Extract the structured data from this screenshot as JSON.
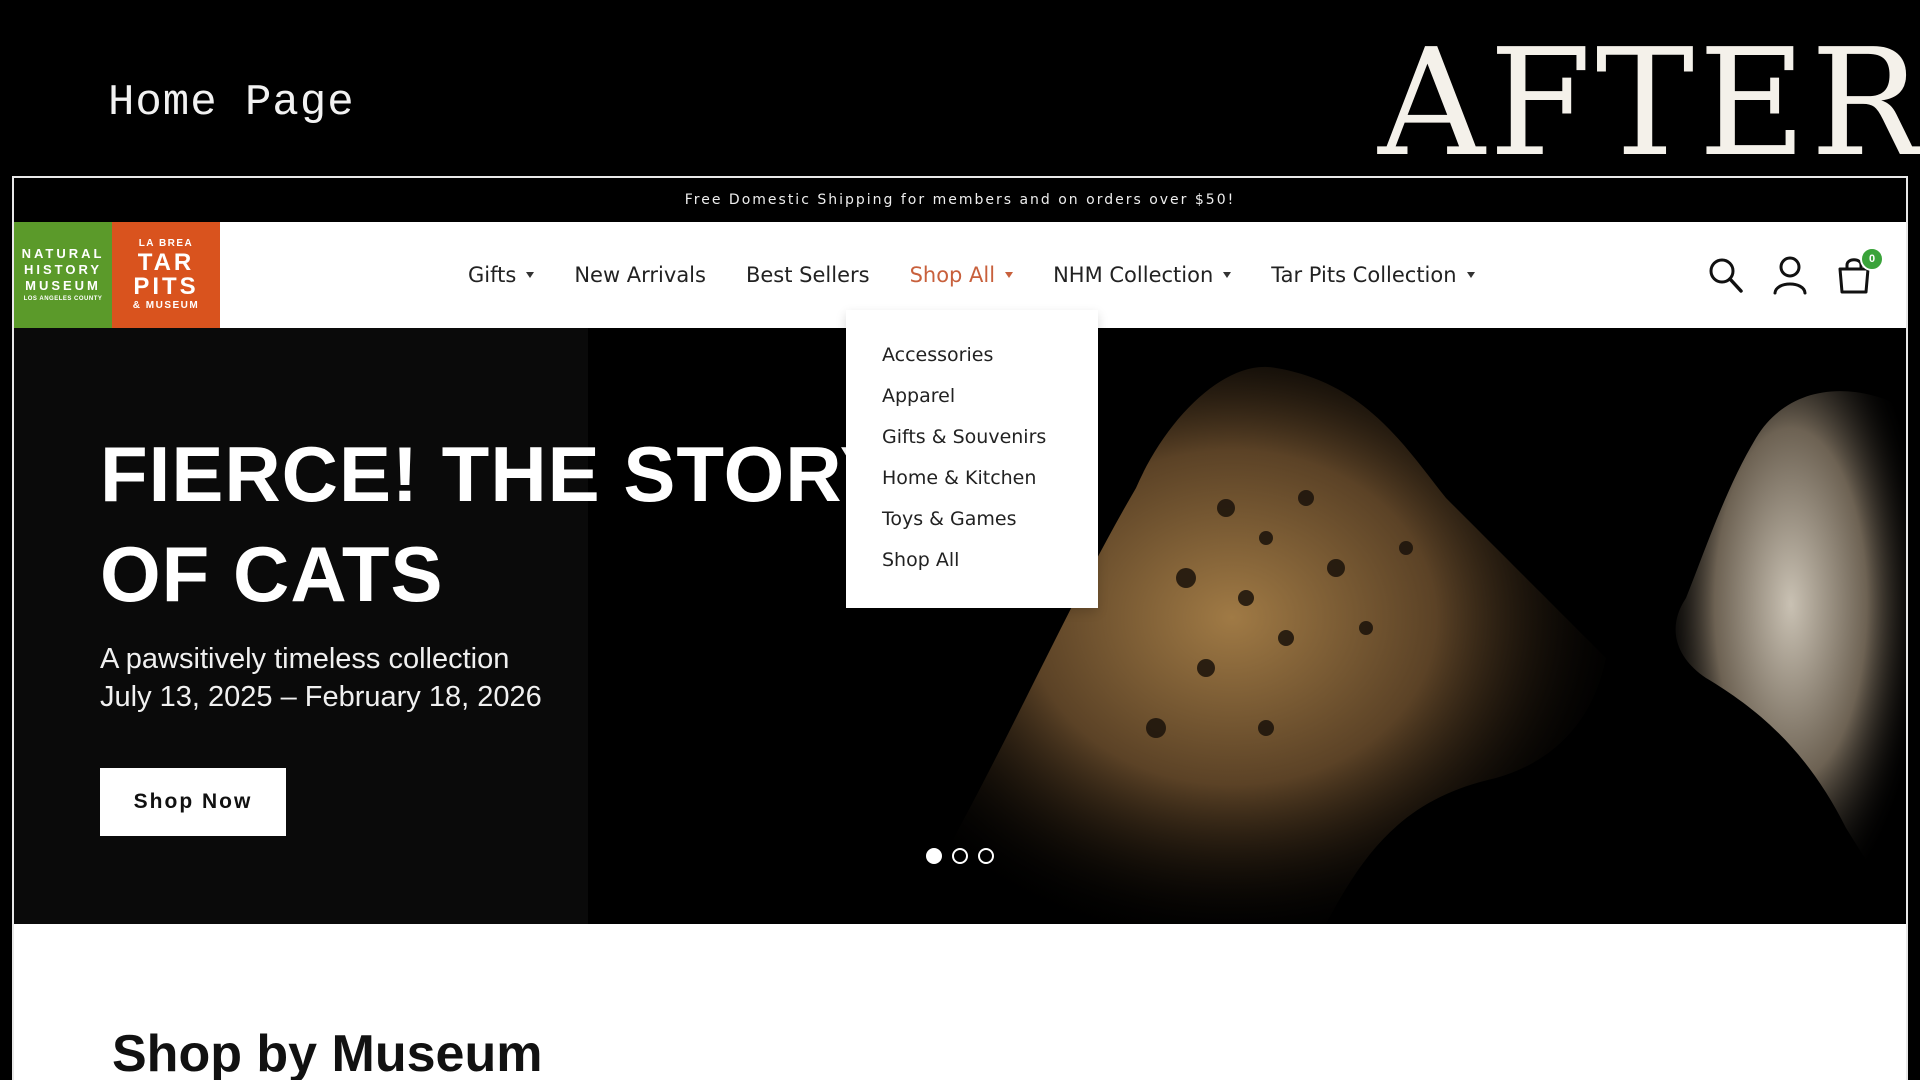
{
  "slide": {
    "label": "Home Page",
    "tag": "AFTER"
  },
  "promo": {
    "text": "Free Domestic Shipping for members and on orders over $50!"
  },
  "logo": {
    "nhm_lines": [
      "NATURAL",
      "HISTORY",
      "MUSEUM",
      "LOS ANGELES COUNTY"
    ],
    "tar_lines": [
      "LA BREA",
      "TAR",
      "PITS",
      "& MUSEUM"
    ]
  },
  "nav": {
    "items": [
      {
        "label": "Gifts",
        "has_caret": true
      },
      {
        "label": "New Arrivals",
        "has_caret": false
      },
      {
        "label": "Best Sellers",
        "has_caret": false
      },
      {
        "label": "Shop All",
        "has_caret": true,
        "active": true
      },
      {
        "label": "NHM Collection",
        "has_caret": true
      },
      {
        "label": "Tar Pits Collection",
        "has_caret": true
      }
    ],
    "icons": [
      "search-icon",
      "account-icon",
      "cart-icon"
    ],
    "cart_count": "0",
    "active_color": "#c8603c",
    "badge_color": "#3aa33a"
  },
  "dropdown": {
    "items": [
      "Accessories",
      "Apparel",
      "Gifts & Souvenirs",
      "Home & Kitchen",
      "Toys & Games",
      "Shop All"
    ]
  },
  "hero": {
    "title_line1": "FIERCE! THE STORY",
    "title_line2": "OF CATS",
    "subtitle_line1": "A pawsitively timeless collection",
    "subtitle_line2": "July 13, 2025 – February 18, 2026",
    "cta": "Shop Now",
    "slides_total": 3,
    "active_slide": 1
  },
  "section": {
    "title": "Shop by Museum"
  }
}
